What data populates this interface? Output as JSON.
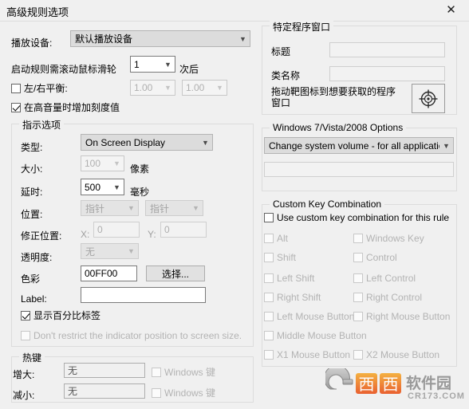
{
  "window": {
    "title": "高级规则选项",
    "close_label": "✕"
  },
  "left": {
    "device_label": "播放设备:",
    "device_value": "默认播放设备",
    "scroll_label": "启动规则需滚动鼠标滑轮",
    "scroll_value": "1",
    "scroll_suffix": "次后",
    "balance_label": "左/右平衡:",
    "balance_checked": false,
    "balance_left": "1.00",
    "balance_right": "1.00",
    "highvol_label": "在高音量时增加刻度值",
    "highvol_checked": true,
    "indicator": {
      "caption": "指示选项",
      "type_label": "类型:",
      "type_value": "On Screen Display",
      "size_label": "大小:",
      "size_value": "100",
      "size_suffix": "像素",
      "delay_label": "延时:",
      "delay_value": "500",
      "delay_suffix": "毫秒",
      "pos_label": "位置:",
      "pos_value_1": "指针",
      "pos_value_2": "指针",
      "fix_label": "修正位置:",
      "fix_x_label": "X:",
      "fix_x_value": "0",
      "fix_y_label": "Y:",
      "fix_y_value": "0",
      "trans_label": "透明度:",
      "trans_value": "无",
      "color_label": "色彩",
      "color_value": "00FF00",
      "color_button": "选择...",
      "text_label": "Label:",
      "text_value": "",
      "percent_label": "显示百分比标签",
      "percent_checked": true,
      "norestrict_label": "Don't restrict the indicator position to screen size.",
      "norestrict_checked": false
    },
    "hotkey": {
      "caption": "热键",
      "up_label": "增大:",
      "up_value": "无",
      "up_win_label": "Windows 键",
      "up_win_checked": false,
      "down_label": "减小:",
      "down_value": "无",
      "down_win_label": "Windows 键",
      "down_win_checked": false
    }
  },
  "right": {
    "specific": {
      "caption": "特定程序窗口",
      "title_label": "标题",
      "title_value": "",
      "class_label": "类名称",
      "class_value": "",
      "drag_hint_line1": "拖动靶图标到想要获取的程序",
      "drag_hint_line2": "窗口",
      "target_icon": "crosshair-target-icon"
    },
    "winopts": {
      "caption": "Windows 7/Vista/2008 Options",
      "mode_value": "Change system volume - for all applications",
      "extra_value": ""
    },
    "custom_keys": {
      "caption": "Custom Key Combination",
      "use_label": "Use custom key combination for this rule",
      "use_checked": false,
      "keys": [
        {
          "label": "Alt",
          "checked": false
        },
        {
          "label": "Windows Key",
          "checked": false
        },
        {
          "label": "Shift",
          "checked": false
        },
        {
          "label": "Control",
          "checked": false
        },
        {
          "label": "Left Shift",
          "checked": false
        },
        {
          "label": "Left Control",
          "checked": false
        },
        {
          "label": "Right Shift",
          "checked": false
        },
        {
          "label": "Right Control",
          "checked": false
        },
        {
          "label": "Left Mouse Button",
          "checked": false
        },
        {
          "label": "Right Mouse Button",
          "checked": false
        },
        {
          "label": "Middle Mouse Button",
          "checked": false
        },
        {
          "label": "X1 Mouse Button",
          "checked": false
        },
        {
          "label": "X2 Mouse Button",
          "checked": false
        }
      ]
    }
  },
  "watermark": {
    "brand_cn": "西西",
    "brand_cn2": "软件园",
    "brand_url": "CR173.COM"
  }
}
